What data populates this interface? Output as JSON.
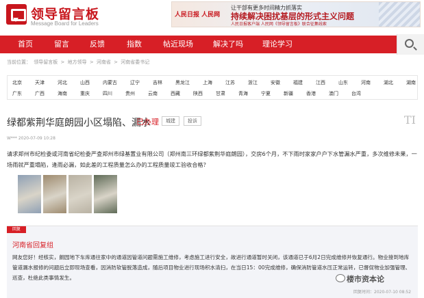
{
  "header": {
    "logo_title": "领导留言板",
    "logo_sub": "Message Board for Leaders",
    "banner": {
      "left_text": "人民日报 人民网",
      "line1": "让干部有更多时间精力抓落实",
      "line2": "持续解决困扰基层的形式主义问题",
      "line3": "人民日报客户端 人民网《领导留言板》联合征集线索"
    }
  },
  "nav": {
    "items": [
      "首页",
      "留言",
      "反馈",
      "指数",
      "帖近现场",
      "解决了吗",
      "理论学习"
    ]
  },
  "breadcrumb": [
    "当前位置：",
    "领导留言板",
    ">",
    "地方领导",
    ">",
    "河南省",
    ">",
    "河南省委书记"
  ],
  "regions": {
    "row1": [
      "北京",
      "天津",
      "河北",
      "山西",
      "内蒙古",
      "辽宁",
      "吉林",
      "黑龙江",
      "上海",
      "江苏",
      "浙江",
      "安徽",
      "福建",
      "江西",
      "山东",
      "河南",
      "湖北",
      "湖南"
    ],
    "row2": [
      "广东",
      "广西",
      "海南",
      "重庆",
      "四川",
      "贵州",
      "云南",
      "西藏",
      "陕西",
      "甘肃",
      "青海",
      "宁夏",
      "新疆",
      "香港",
      "澳门",
      "台湾"
    ]
  },
  "post": {
    "title": "绿都紫荆华庭朗园小区塌陷、漏水",
    "status": "已办理",
    "tags": [
      "城建",
      "投诉"
    ],
    "text_icon": "TI",
    "meta": "W***    2020-07-09 10:28",
    "body": "请求郑州市纪检委或河南省纪检委严查郑州市绿基置业有限公司（郑州南三环绿都紫荆华庭朗园），交房6个月，不下雨时家家户户下水管漏水严重，多次维修未果，一场雨就严重塌陷，逢雨必漏，如此差的工程质量怎么办的工程质量竣工验收合格？",
    "photo_colors": [
      "#8fa0b5",
      "#9e8b6f",
      "#b9b2a3",
      "#5f6b57"
    ]
  },
  "reply": {
    "tag": "回复",
    "title": "河南省回复组",
    "body": "网友您好！经核实，朗园地下车库通往家中的通道因管道问题需施工维修，考虑施工进行安全，故进行通道暂时关闭，该通道已于6月2日完成维修并恢复通行。物业接到地库管道漏水报修的问题后立即现场查看，因消防软管脱落造成，随后项目物业进行现场积水清扫，在当日15：00完成维修，确保消防管道水压正常运转，已督促物业加强管理、巡查，杜绝此类事情发生。",
    "date": "回复时间：2020-07-10 08:52"
  },
  "watermark": "楼市资本论",
  "colors": {
    "brand_red": "#d71f26",
    "nav_bg": "#d71f26",
    "reply_bg": "#f3f4f8"
  }
}
